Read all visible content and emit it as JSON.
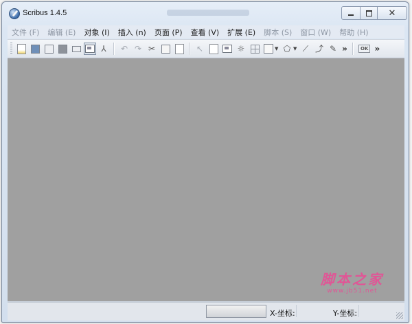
{
  "window": {
    "title": "Scribus 1.4.5"
  },
  "menubar": {
    "items": [
      {
        "label": "文件 (F)",
        "enabled": false
      },
      {
        "label": "编辑 (E)",
        "enabled": false
      },
      {
        "label": "对象 (I)",
        "enabled": true
      },
      {
        "label": "插入 (n)",
        "enabled": true
      },
      {
        "label": "页面 (P)",
        "enabled": true
      },
      {
        "label": "查看 (V)",
        "enabled": true
      },
      {
        "label": "扩展 (E)",
        "enabled": true
      },
      {
        "label": "脚本 (S)",
        "enabled": false
      },
      {
        "label": "窗口 (W)",
        "enabled": false
      },
      {
        "label": "帮助 (H)",
        "enabled": false
      }
    ]
  },
  "toolbar": {
    "overflow_label": "»",
    "ok_label": "OK",
    "overflow2_label": "»"
  },
  "statusbar": {
    "x_label": "X-坐标:",
    "y_label": "Y-坐标:"
  },
  "watermark": {
    "main": "脚本之家",
    "sub": "www.jb51.net"
  },
  "colors": {
    "canvas": "#a0a0a0",
    "watermark": "#e05696"
  }
}
